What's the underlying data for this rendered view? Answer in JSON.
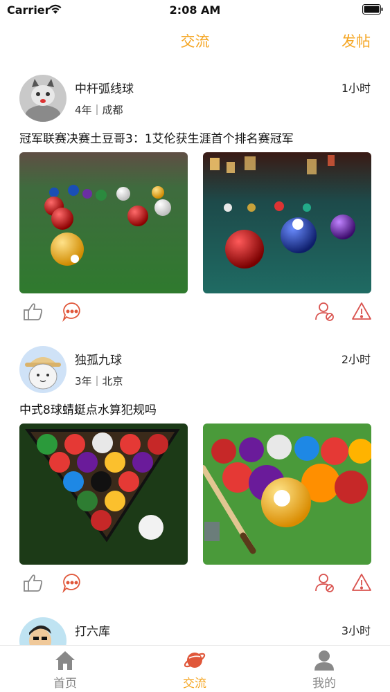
{
  "status_bar": {
    "carrier": "Carrier",
    "time": "2:08 AM"
  },
  "header": {
    "title": "交流",
    "action": "发帖"
  },
  "posts": [
    {
      "author": "中杆弧线球",
      "meta": "4年｜成都",
      "time": "1小时",
      "title": "冠军联赛决赛土豆哥3：1艾伦获生涯首个排名赛冠军"
    },
    {
      "author": "独孤九球",
      "meta": "3年｜北京",
      "time": "2小时",
      "title": "中式8球蜻蜓点水算犯规吗"
    },
    {
      "author": "打六库",
      "meta": "",
      "time": "3小时",
      "title": ""
    }
  ],
  "tabbar": {
    "items": [
      {
        "label": "首页",
        "icon": "home-icon"
      },
      {
        "label": "交流",
        "icon": "planet-icon"
      },
      {
        "label": "我的",
        "icon": "user-icon"
      }
    ]
  },
  "colors": {
    "accent": "#f5a623",
    "action_red": "#d9534f"
  }
}
